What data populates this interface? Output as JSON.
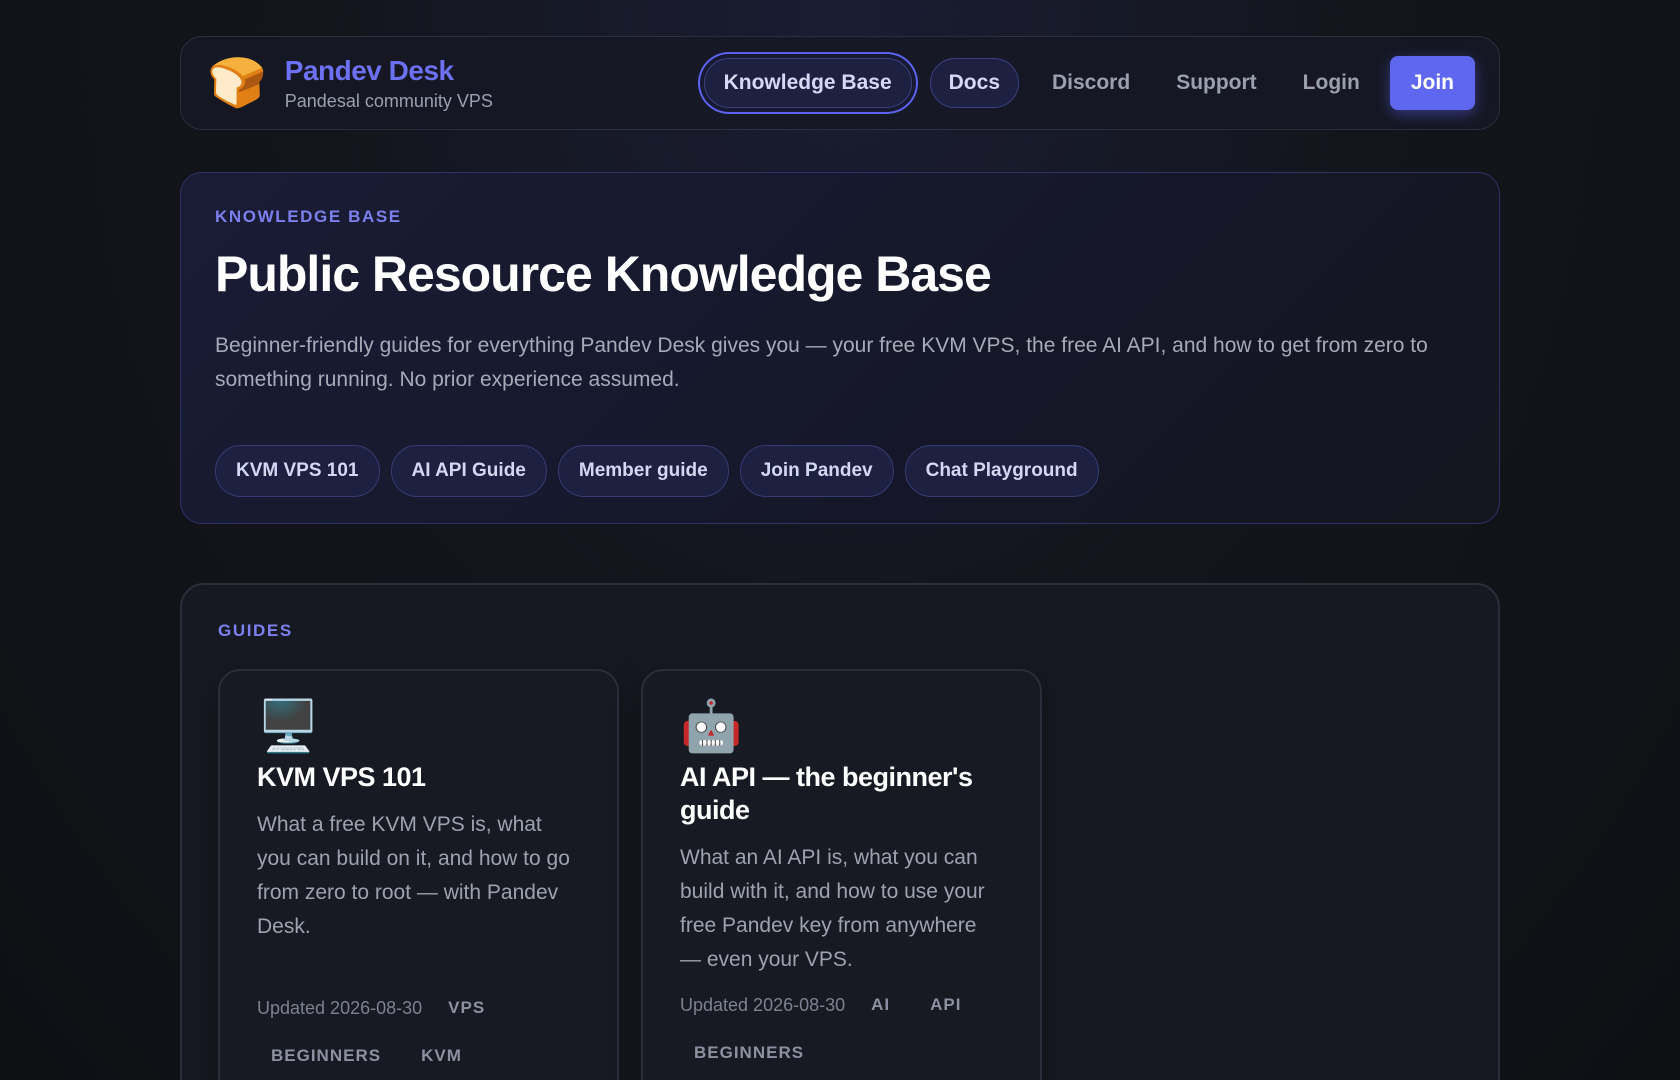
{
  "nav": {
    "logo_emoji": "🍞",
    "brand_name": "Pandev Desk",
    "brand_sub": "Pandesal community VPS",
    "links": [
      "Knowledge Base",
      "Docs",
      "Discord",
      "Support",
      "Login"
    ],
    "join_label": "Join"
  },
  "hero": {
    "eyebrow": "KNOWLEDGE BASE",
    "title": "Public Resource Knowledge Base",
    "description": "Beginner-friendly guides for everything Pandev Desk gives you — your free KVM VPS, the free AI API, and how to get from zero to something running. No prior experience assumed.",
    "chips": [
      "KVM VPS 101",
      "AI API Guide",
      "Member guide",
      "Join Pandev",
      "Chat Playground"
    ]
  },
  "guides": {
    "eyebrow": "GUIDES",
    "cards": [
      {
        "icon": "🖥️",
        "icon_name": "desktop-computer-icon",
        "title": "KVM VPS 101",
        "description": "What a free KVM VPS is, what you can build on it, and how to go from zero to root — with Pandev Desk.",
        "updated": "Updated 2026-08-30",
        "tags": [
          "VPS",
          "BEGINNERS",
          "KVM"
        ]
      },
      {
        "icon": "🤖",
        "icon_name": "robot-icon",
        "title": "AI API — the beginner's guide",
        "description": "What an AI API is, what you can build with it, and how to use your free Pandev key from anywhere — even your VPS.",
        "updated": "Updated 2026-08-30",
        "tags": [
          "AI",
          "API",
          "BEGINNERS"
        ]
      }
    ]
  },
  "colors": {
    "accent": "#5f66f0",
    "brand": "#6b71f2",
    "background": "#13151c"
  }
}
